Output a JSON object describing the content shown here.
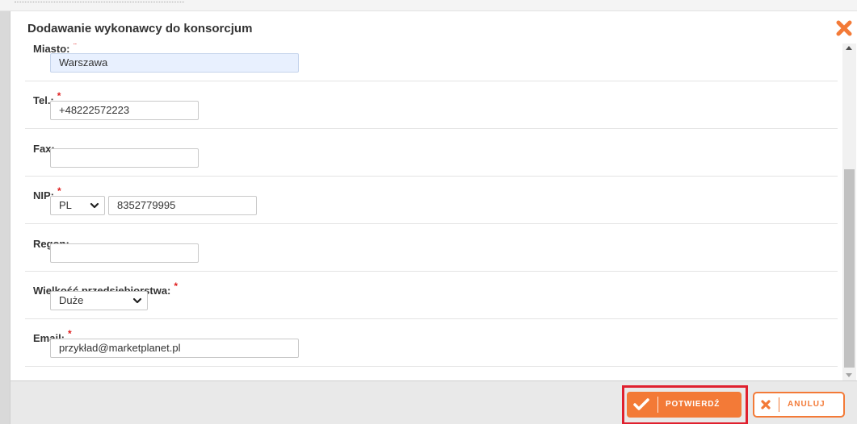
{
  "modal": {
    "title": "Dodawanie wykonawcy do konsorcjum",
    "close_icon": "close-x-icon"
  },
  "form": {
    "required_marker": "*",
    "miasto": {
      "label": "Miasto:",
      "value": "Warszawa"
    },
    "tel": {
      "label": "Tel.:",
      "value": "+48222572223"
    },
    "fax": {
      "label": "Fax:",
      "value": ""
    },
    "nip": {
      "label": "NIP:",
      "country": "PL",
      "value": "8352779995"
    },
    "regon": {
      "label": "Regon:",
      "value": ""
    },
    "wielkosc": {
      "label": "Wielkość przedsiębiorstwa:",
      "value": "Duże"
    },
    "email": {
      "label": "Email:",
      "value": "przykład@marketplanet.pl"
    }
  },
  "footer": {
    "confirm_label": "POTWIERDŹ",
    "cancel_label": "ANULUJ"
  },
  "colors": {
    "accent": "#f37a37",
    "required": "#e02020",
    "highlight": "#e0202e"
  }
}
